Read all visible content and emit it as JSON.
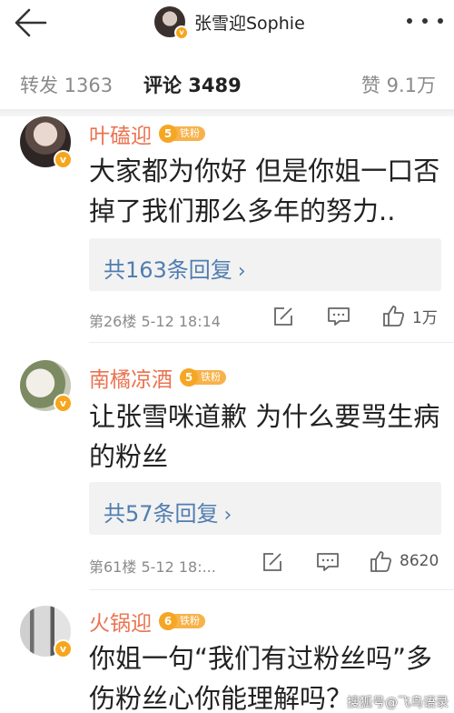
{
  "header": {
    "account_name": "张雪迎Sophie",
    "verified_badge": "v"
  },
  "tabs": {
    "repost": "转发 1363",
    "comments": "评论 3489",
    "likes": "赞 9.1万"
  },
  "comments": [
    {
      "username": "叶磕迎",
      "fan_level": "5",
      "fan_label": "铁粉",
      "text": "大家都为你好 但是你姐一口否掉了我们那么多年的努力..",
      "replies": "共163条回复",
      "meta": "第26楼  5-12 18:14",
      "likes": "1万"
    },
    {
      "username": "南橘凉酒",
      "fan_level": "5",
      "fan_label": "铁粉",
      "text": "让张雪咪道歉 为什么要骂生病的粉丝",
      "replies": "共57条回复",
      "meta": "第61楼  5-12 18:...",
      "likes": "8620"
    },
    {
      "username": "火锅迎",
      "fan_level": "6",
      "fan_label": "铁粉",
      "text": "你姐一句“我们有过粉丝吗”多伤粉丝心你能理解吗？",
      "replies": "",
      "meta": "",
      "likes": ""
    }
  ],
  "icons": {
    "back": "arrow-left-icon",
    "more": "more-dots-icon",
    "edit": "repost-edit-icon",
    "comment": "comment-bubble-icon",
    "like": "thumbs-up-icon"
  },
  "colors": {
    "username": "#eb7350",
    "reply_link": "#507daf",
    "tab_indicator": "#ff8200",
    "fan_badge": "#f5a623"
  },
  "watermark": "搜狐号@飞鸟语录",
  "chevron": "›"
}
